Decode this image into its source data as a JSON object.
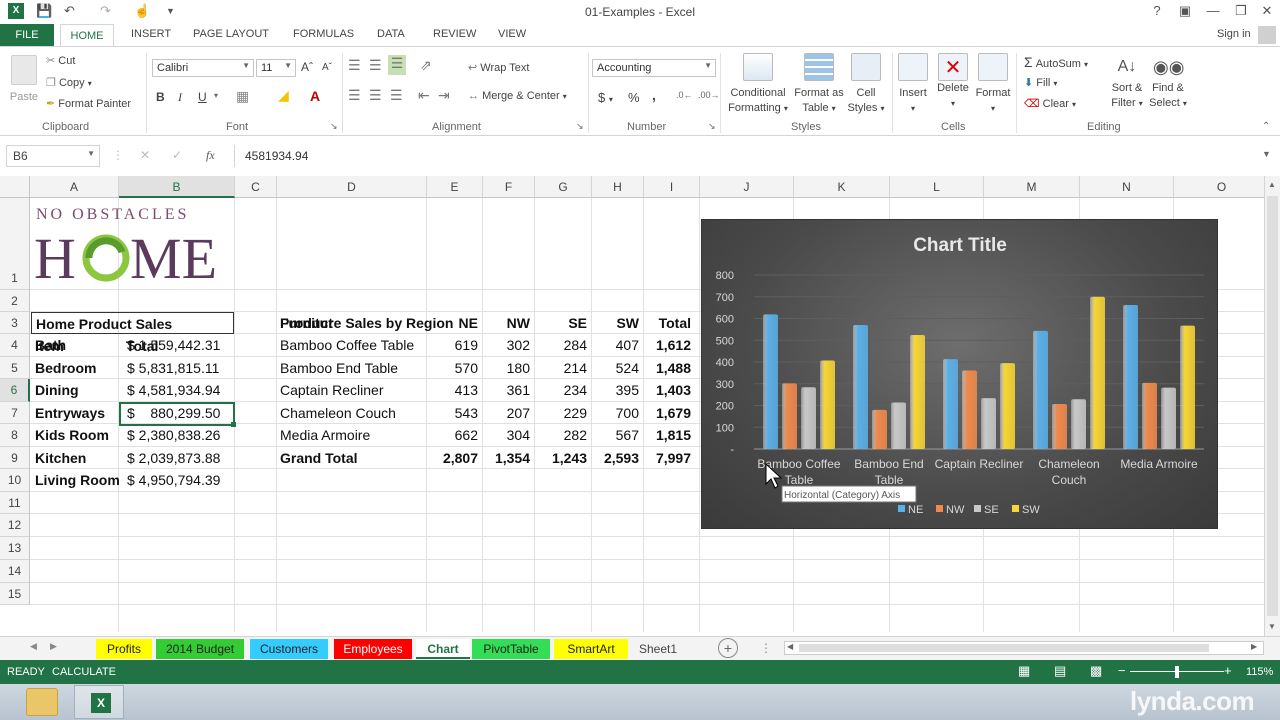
{
  "titlebar": {
    "title": "01-Examples - Excel",
    "help": "?",
    "signin": "Sign in"
  },
  "tabs": [
    "FILE",
    "HOME",
    "INSERT",
    "PAGE LAYOUT",
    "FORMULAS",
    "DATA",
    "REVIEW",
    "VIEW"
  ],
  "ribbon": {
    "clipboard": {
      "paste": "Paste",
      "cut": "Cut",
      "copy": "Copy",
      "format_painter": "Format Painter",
      "label": "Clipboard"
    },
    "font": {
      "name": "Calibri",
      "size": "11",
      "bold": "B",
      "italic": "I",
      "underline": "U",
      "label": "Font"
    },
    "alignment": {
      "wrap": "Wrap Text",
      "merge": "Merge & Center",
      "label": "Alignment"
    },
    "number": {
      "format": "Accounting",
      "currency": "$",
      "percent": "%",
      "comma": ",",
      "label": "Number"
    },
    "styles": {
      "conditional_1": "Conditional",
      "conditional_2": "Formatting",
      "format_table_1": "Format as",
      "format_table_2": "Table",
      "cell_styles_1": "Cell",
      "cell_styles_2": "Styles",
      "label": "Styles"
    },
    "cells": {
      "insert": "Insert",
      "delete": "Delete",
      "format": "Format",
      "label": "Cells"
    },
    "editing": {
      "autosum": "AutoSum",
      "fill": "Fill",
      "clear": "Clear",
      "sort_1": "Sort &",
      "sort_2": "Filter",
      "find_1": "Find &",
      "find_2": "Select",
      "label": "Editing"
    }
  },
  "formula_bar": {
    "name_box": "B6",
    "fx": "fx",
    "value": "4581934.94"
  },
  "columns": [
    "A",
    "B",
    "C",
    "D",
    "E",
    "F",
    "G",
    "H",
    "I",
    "J",
    "K",
    "L",
    "M",
    "N",
    "O"
  ],
  "rows": [
    "1",
    "2",
    "3",
    "4",
    "5",
    "6",
    "7",
    "8",
    "9",
    "10",
    "11",
    "12",
    "13",
    "14",
    "15"
  ],
  "logo": {
    "line1": "NO OBSTACLES",
    "line2": "HOME"
  },
  "left_table": {
    "title": "Home Product Sales",
    "headers": [
      "Item",
      "Total"
    ],
    "rows": [
      [
        "Bath",
        "$ 1,559,442.31"
      ],
      [
        "Bedroom",
        "$ 5,831,815.11"
      ],
      [
        "Dining",
        "$ 4,581,934.94"
      ],
      [
        "Entryways",
        "$    880,299.50"
      ],
      [
        "Kids Room",
        "$ 2,380,838.26"
      ],
      [
        "Kitchen",
        "$ 2,039,873.88"
      ],
      [
        "Living Room",
        "$ 4,950,794.39"
      ]
    ]
  },
  "right_table": {
    "title": "Furniture Sales by Region",
    "headers": [
      "Product",
      "NE",
      "NW",
      "SE",
      "SW",
      "Total"
    ],
    "rows": [
      [
        "Bamboo Coffee Table",
        "619",
        "302",
        "284",
        "407",
        "1,612"
      ],
      [
        "Bamboo End Table",
        "570",
        "180",
        "214",
        "524",
        "1,488"
      ],
      [
        "Captain Recliner",
        "413",
        "361",
        "234",
        "395",
        "1,403"
      ],
      [
        "Chameleon Couch",
        "543",
        "207",
        "229",
        "700",
        "1,679"
      ],
      [
        "Media Armoire",
        "662",
        "304",
        "282",
        "567",
        "1,815"
      ]
    ],
    "grand_total": [
      "Grand Total",
      "2,807",
      "1,354",
      "1,243",
      "2,593",
      "7,997"
    ]
  },
  "chart_data": {
    "type": "bar",
    "title": "Chart Title",
    "categories": [
      "Bamboo Coffee Table",
      "Bamboo End Table",
      "Captain Recliner",
      "Chameleon Couch",
      "Media Armoire"
    ],
    "series": [
      {
        "name": "NE",
        "values": [
          619,
          570,
          413,
          543,
          662
        ],
        "color": "#5ab0e8"
      },
      {
        "name": "NW",
        "values": [
          302,
          180,
          361,
          207,
          304
        ],
        "color": "#f08a4b"
      },
      {
        "name": "SE",
        "values": [
          284,
          214,
          234,
          229,
          282
        ],
        "color": "#c8c8c8"
      },
      {
        "name": "SW",
        "values": [
          407,
          524,
          395,
          700,
          567
        ],
        "color": "#f6d534"
      }
    ],
    "ylim": [
      0,
      800
    ],
    "yticks": [
      "800",
      "700",
      "600",
      "500",
      "400",
      "300",
      "200",
      "100",
      "-"
    ],
    "legend": "bottom",
    "tooltip": "Horizontal (Category) Axis",
    "xlabel_lines": [
      [
        "Bamboo Coffee",
        "Table"
      ],
      [
        "Bamboo End",
        "Table"
      ],
      [
        "Captain Recliner",
        ""
      ],
      [
        "Chameleon",
        "Couch"
      ],
      [
        "Media Armoire",
        ""
      ]
    ]
  },
  "sheet_tabs": [
    {
      "name": "Profits",
      "color": "#ffff00"
    },
    {
      "name": "2014 Budget",
      "color": "#33cc33"
    },
    {
      "name": "Customers",
      "color": "#33ccff"
    },
    {
      "name": "Employees",
      "color": "#ff0000"
    },
    {
      "name": "Chart",
      "color": "#ffffff"
    },
    {
      "name": "PivotTable",
      "color": "#33dd55"
    },
    {
      "name": "SmartArt",
      "color": "#ffff00"
    },
    {
      "name": "Sheet1",
      "color": "#f3f3f3"
    }
  ],
  "status": {
    "ready": "READY",
    "calculate": "CALCULATE",
    "zoom": "115%"
  },
  "watermark": "lynda.com"
}
